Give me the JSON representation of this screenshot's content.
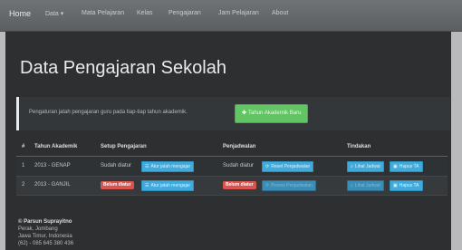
{
  "navbar": {
    "brand": "Home",
    "items": [
      {
        "label": "Data ▾"
      },
      {
        "label": "Mata Pelajaran"
      },
      {
        "label": "Kelas"
      },
      {
        "label": "Pengajaran"
      },
      {
        "label": "Jam Pelajaran"
      },
      {
        "label": "About"
      }
    ]
  },
  "page": {
    "title": "Data Pengajaran Sekolah",
    "info_text": "Pengaturan jatah pengajaran guru pada tiap-tiap tahun akademik.",
    "new_year_button": "Tahun Akademik Baru"
  },
  "table": {
    "headers": [
      "#",
      "Tahun Akademik",
      "Setup Pengajaran",
      "Penjadwalan",
      "Tindakan"
    ],
    "rows": [
      {
        "no": "1",
        "year": "2013 - GENAP",
        "setup_status": "Sudah diatur",
        "setup_button": "Atur jatah mengajar",
        "schedule_status": "Sudah diatur",
        "schedule_button": "Reset Penjadwalan",
        "view_button": "Lihat Jadwal",
        "delete_button": "Hapus TA"
      },
      {
        "no": "2",
        "year": "2013 - GANJIL",
        "setup_status": "Belum diatur",
        "setup_button": "Atur jatah mengajar",
        "schedule_status": "Belum diatur",
        "schedule_button": "Proses Penjadwalan",
        "view_button": "Lihat Jadwal",
        "delete_button": "Hapus TA"
      }
    ]
  },
  "footer": {
    "name": "© Parsun Suprayitno",
    "line1": "Perak, Jombang",
    "line2": "Jawa Timur, Indonesia",
    "line3": "(62) - 085 645 380 436"
  },
  "colors": {
    "navbar": "#66696c",
    "panel": "#2d2f31",
    "green_button": "#62c462",
    "info_button": "#3faadb",
    "danger_badge": "#d9534f"
  }
}
